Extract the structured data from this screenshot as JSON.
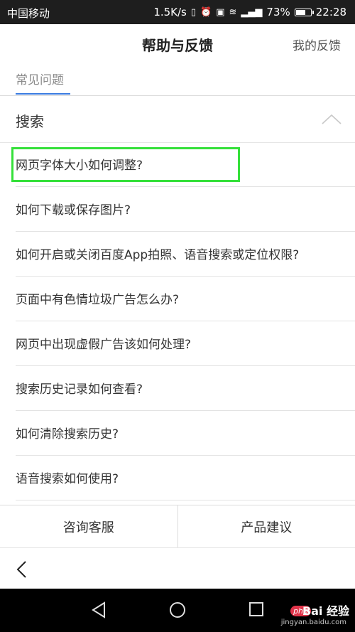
{
  "status_bar": {
    "carrier": "中国移动",
    "network_speed": "1.5K/s",
    "battery_percent": "73%",
    "battery_level": 0.73,
    "time": "22:28"
  },
  "header": {
    "title": "帮助与反馈",
    "feedback_link": "我的反馈"
  },
  "tabs": [
    {
      "label": "常见问题",
      "active": true
    }
  ],
  "section": {
    "title": "搜索",
    "expanded": true
  },
  "faq_items": [
    "网页字体大小如何调整?",
    "如何下载或保存图片?",
    "如何开启或关闭百度App拍照、语音搜索或定位权限?",
    "页面中有色情垃圾广告怎么办?",
    "网页中出现虚假广告该如何处理?",
    "搜索历史记录如何查看?",
    "如何清除搜索历史?",
    "语音搜索如何使用?"
  ],
  "bottom_actions": {
    "consult": "咨询客服",
    "suggest": "产品建议"
  },
  "watermark": {
    "brand": "Bai 经验",
    "site": "jingyan.baidu.com",
    "php": "php"
  },
  "colors": {
    "highlight": "#35e03a",
    "tab_accent": "#3a7be0",
    "status_bar": "#1e1e1e"
  }
}
